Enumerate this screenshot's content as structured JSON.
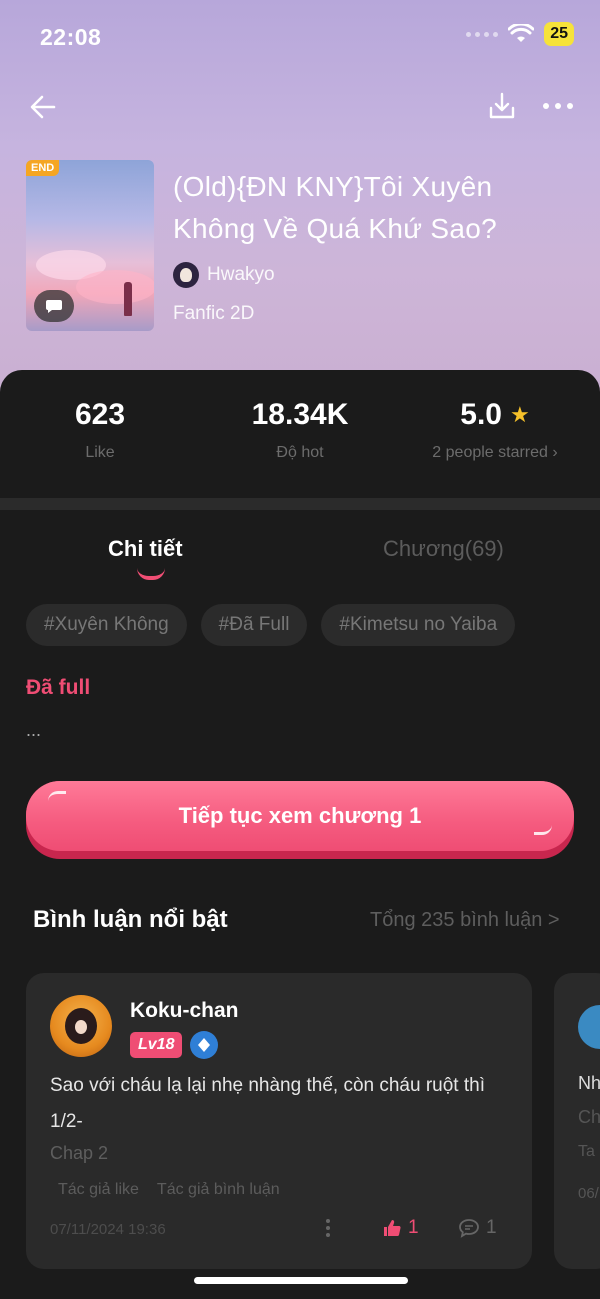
{
  "status_bar": {
    "time": "22:08",
    "battery": "25"
  },
  "book": {
    "cover_badge": "END",
    "title": "(Old){ĐN KNY}Tôi Xuyên Không Về Quá Khứ Sao?",
    "author": "Hwakyo",
    "genre": "Fanfic 2D"
  },
  "stats": {
    "likes": {
      "value": "623",
      "label": "Like"
    },
    "hot": {
      "value": "18.34K",
      "label": "Độ hot"
    },
    "rating": {
      "value": "5.0",
      "label": "2 people starred ›"
    }
  },
  "tabs": [
    {
      "label": "Chi tiết",
      "active": true
    },
    {
      "label": "Chương(69)",
      "active": false
    }
  ],
  "tags": [
    "#Xuyên Không",
    "#Đã Full",
    "#Kimetsu no Yaiba"
  ],
  "status_text": "Đã full",
  "description": "...",
  "cta_label": "Tiếp tục xem chương 1",
  "comments": {
    "title": "Bình luận nổi bật",
    "total": "Tổng 235 bình luận >",
    "items": [
      {
        "username": "Koku-chan",
        "level": "Lv18",
        "text": "Sao với cháu lạ lại nhẹ nhàng thế, còn cháu ruột thì 1/2-",
        "chapter": "Chap 2",
        "tag_author_like": "Tác giả like",
        "tag_author_comment": "Tác giả bình luận",
        "date": "07/11/2024 19:36",
        "likes": "1",
        "replies": "1"
      }
    ],
    "next_peek": {
      "line1": "Nh",
      "line2": "Ch",
      "line3": "Ta",
      "line4": "06/"
    }
  },
  "colors": {
    "accent": "#ef4d74",
    "star": "#f6c12a",
    "background": "#1b1b1b"
  }
}
